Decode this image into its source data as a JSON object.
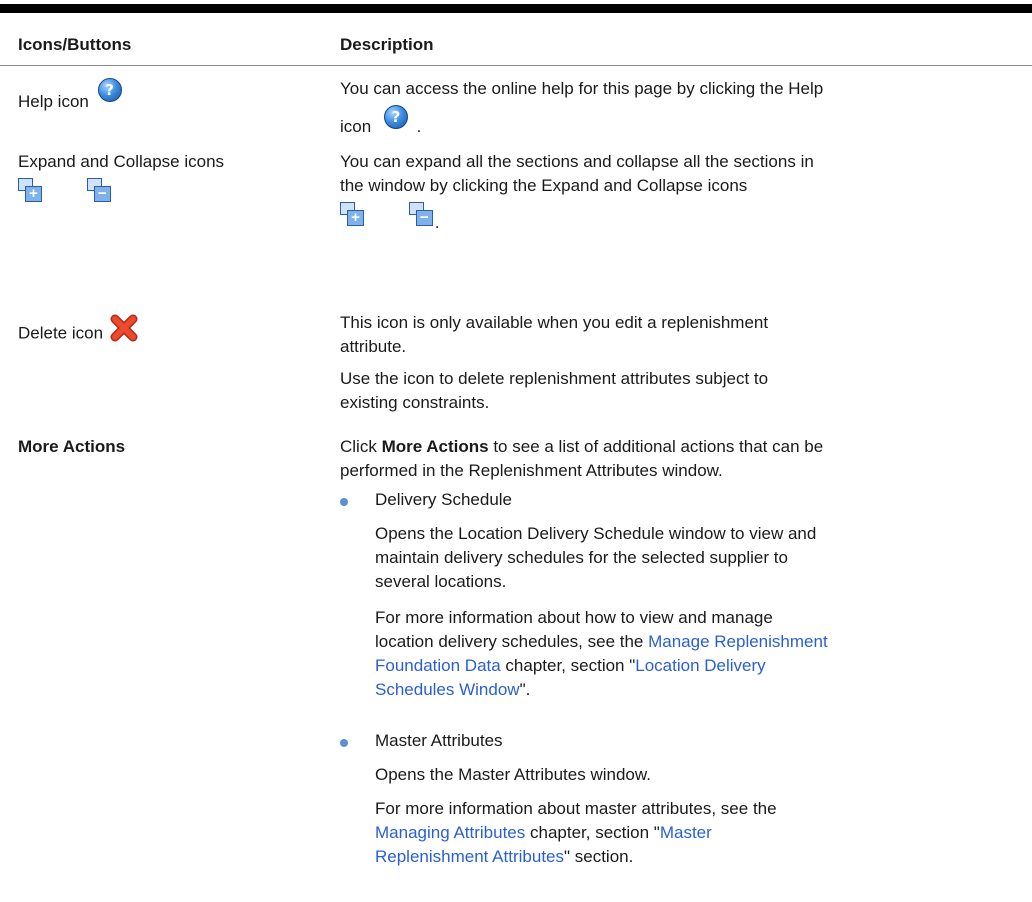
{
  "table": {
    "headers": [
      "Icons/Buttons",
      "Description"
    ]
  },
  "rows": {
    "help": {
      "label": "Help icon",
      "desc_before": "You can access the online help for this page by clicking the Help",
      "desc_icon_word": "icon",
      "desc_end": "."
    },
    "expand": {
      "label": "Expand and Collapse icons",
      "desc_line1": "You can expand all the sections and collapse all the sections in",
      "desc_line2": "the window by clicking the Expand and Collapse icons",
      "desc_end": "."
    },
    "delete": {
      "label": "Delete icon",
      "desc1_line1": "This icon is only available when you edit a replenishment",
      "desc1_line2": "attribute.",
      "desc2_line1": "Use the icon to delete replenishment attributes subject to",
      "desc2_line2": "existing constraints."
    },
    "more": {
      "label": "More Actions",
      "intro_click": "Click ",
      "intro_bold": "More Actions",
      "intro_rest": " to see a list of additional actions that can be",
      "intro_line2": "performed in the Replenishment Attributes window.",
      "items": [
        {
          "title": "Delivery Schedule",
          "desc": [
            "Opens the Location Delivery Schedule window to view and",
            "maintain delivery schedules for the selected supplier to",
            "several locations."
          ],
          "more_line1": "For more information about how to view and manage",
          "more_line2_pre": "location delivery schedules, see the ",
          "link1_a": "Manage Replenishment",
          "link1_b": "Foundation Data",
          "more_mid": " chapter, section \"",
          "link2_a": "Location Delivery",
          "link2_b": "Schedules Window",
          "more_end": "\"."
        },
        {
          "title": "Master Attributes",
          "desc": [
            "Opens the Master Attributes window."
          ],
          "more_line1": "For more information about master attributes, see the",
          "link1": "Managing Attributes",
          "more_mid": " chapter, section \"",
          "link2_a": "Master",
          "link2_b": "Replenishment Attributes",
          "more_end": "\" section."
        }
      ]
    }
  },
  "icons": {
    "help_icon_symbol": "?",
    "expand_icon_symbol": "+",
    "collapse_icon_symbol": "−",
    "delete_icon_color": "#e23b1d"
  }
}
